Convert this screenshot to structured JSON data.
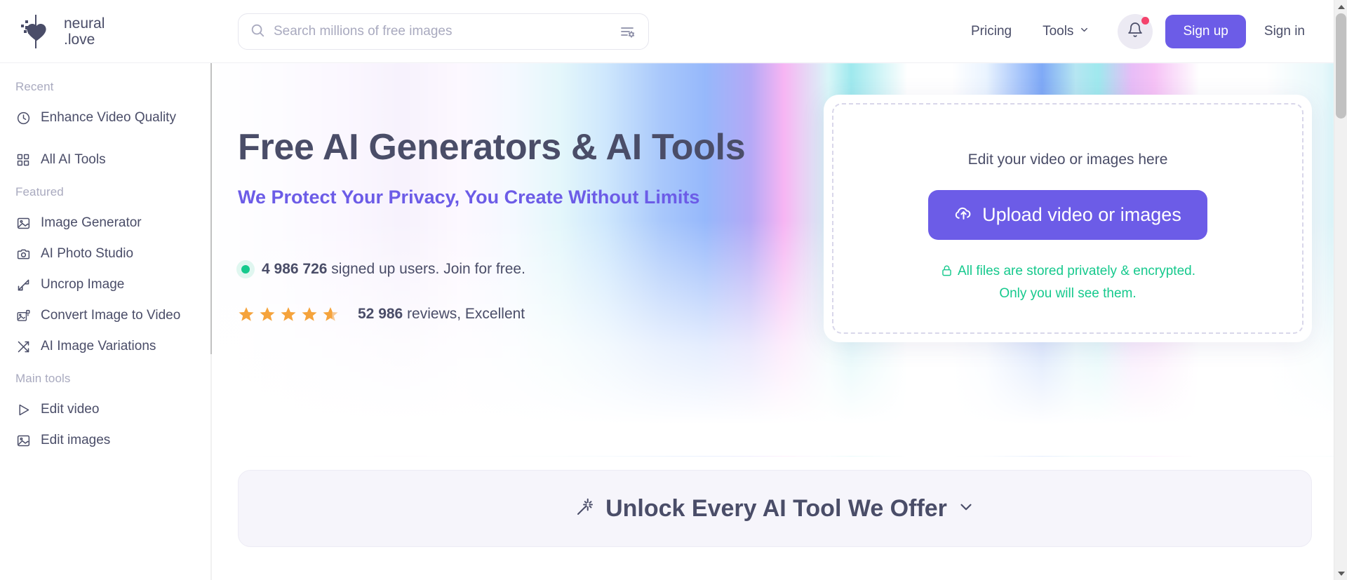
{
  "brand": {
    "name_line1": "neural",
    "name_line2": ".love",
    "logo_icon": "pixel-heart-icon",
    "accent_purple": "#6c5ce7",
    "text_color": "#4a4d68",
    "green": "#16c98d",
    "star_color": "#f5a33c"
  },
  "search": {
    "placeholder": "Search millions of free images",
    "value": "",
    "search_icon": "search-icon",
    "filter_icon": "filter-settings-icon"
  },
  "header": {
    "pricing_label": "Pricing",
    "tools_label": "Tools",
    "tools_chevron": "chevron-down-icon",
    "bell_icon": "bell-icon",
    "bell_has_notification": true,
    "signup_label": "Sign up",
    "signin_label": "Sign in"
  },
  "sidebar": {
    "groups": [
      {
        "label": "Recent",
        "items": [
          {
            "label": "Enhance Video Quality",
            "icon": "clock-icon"
          },
          {
            "label": "All AI Tools",
            "icon": "grid-icon"
          }
        ]
      },
      {
        "label": "Featured",
        "items": [
          {
            "label": "Image Generator",
            "icon": "image-icon"
          },
          {
            "label": "AI Photo Studio",
            "icon": "camera-icon"
          },
          {
            "label": "Uncrop Image",
            "icon": "expand-arrows-icon"
          },
          {
            "label": "Convert Image to Video",
            "icon": "image-to-video-icon"
          },
          {
            "label": "AI Image Variations",
            "icon": "shuffle-icon"
          }
        ]
      },
      {
        "label": "Main tools",
        "items": [
          {
            "label": "Edit video",
            "icon": "play-triangle-icon"
          },
          {
            "label": "Edit images",
            "icon": "image-icon"
          }
        ]
      }
    ]
  },
  "hero": {
    "title": "Free AI Generators & AI Tools",
    "subtitle": "We Protect Your Privacy, You Create Without Limits",
    "signed_up_count": "4 986 726",
    "signed_up_suffix": " signed up users. Join for free.",
    "reviews_count": "52 986",
    "reviews_suffix": " reviews, Excellent",
    "stars_filled": 4.5,
    "stars_total": 5
  },
  "upload": {
    "hint": "Edit your video or images here",
    "button_label": "Upload video or images",
    "button_icon": "cloud-upload-icon",
    "privacy_icon": "lock-icon",
    "privacy_line1": "All files are stored privately & encrypted.",
    "privacy_line2": "Only you will see them."
  },
  "banner": {
    "icon": "magic-wand-icon",
    "title": "Unlock Every AI Tool We Offer",
    "chevron": "chevron-down-icon"
  }
}
